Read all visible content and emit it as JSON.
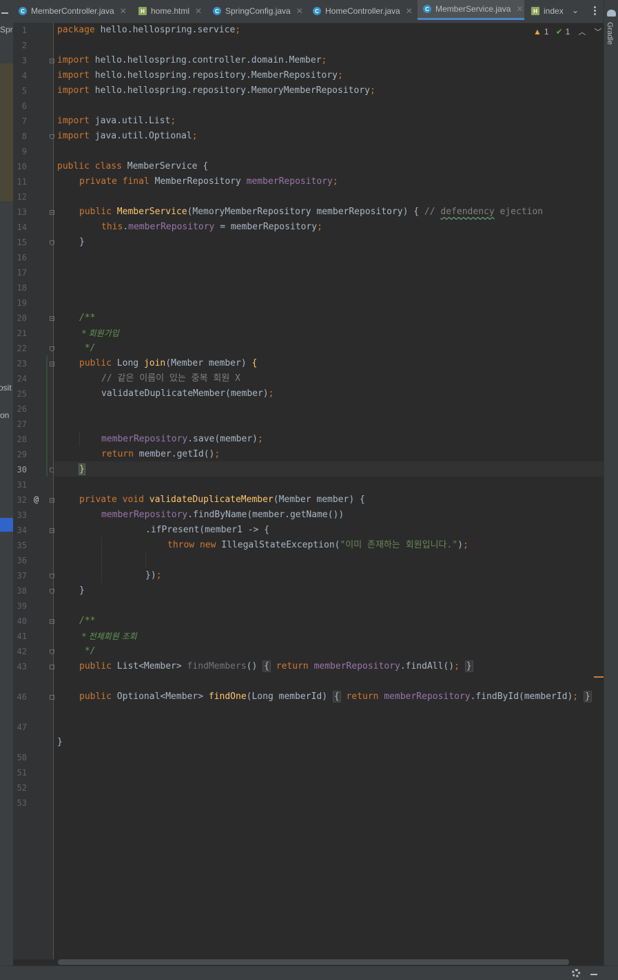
{
  "tabs": [
    {
      "label": "MemberController.java",
      "icon": "java-class-icon",
      "active": false
    },
    {
      "label": "home.html",
      "icon": "html-file-icon",
      "active": false
    },
    {
      "label": "SpringConfig.java",
      "icon": "java-class-icon",
      "active": false
    },
    {
      "label": "HomeController.java",
      "icon": "java-class-icon",
      "active": false
    },
    {
      "label": "MemberService.java",
      "icon": "java-class-icon",
      "active": true
    },
    {
      "label": "index",
      "icon": "html-file-icon",
      "active": false
    }
  ],
  "left_pane_fragments": {
    "top": "Spr",
    "mid1": "osit",
    "mid2": "on"
  },
  "right_tool_window": {
    "label": "Gradle"
  },
  "inspection": {
    "warnings": "1",
    "ok": "1"
  },
  "editor": {
    "current_line": "30",
    "line_numbers": [
      "1",
      "2",
      "3",
      "4",
      "5",
      "6",
      "7",
      "8",
      "9",
      "10",
      "11",
      "12",
      "13",
      "14",
      "15",
      "16",
      "17",
      "18",
      "19",
      "20",
      "21",
      "22",
      "23",
      "24",
      "25",
      "26",
      "27",
      "28",
      "29",
      "30",
      "31",
      "32",
      "33",
      "34",
      "35",
      "36",
      "37",
      "38",
      "39",
      "40",
      "41",
      "42",
      "43",
      "46",
      "47",
      "50",
      "51",
      "52",
      "53"
    ],
    "code": {
      "l1_kw": "package",
      "l1_rest": " hello.hellospring.service",
      "l3_kw": "import",
      "l3_rest": " hello.hellospring.controller.domain.Member",
      "l4_kw": "import",
      "l4_rest": " hello.hellospring.repository.MemberRepository",
      "l5_kw": "import",
      "l5_rest": " hello.hellospring.repository.MemoryMemberRepository",
      "l7_kw": "import",
      "l7_rest": " java.util.List",
      "l8_kw": "import",
      "l8_rest": " java.util.Optional",
      "l10_kw": "public class",
      "l10_rest": " MemberService {",
      "l11_kw": "private final",
      "l11_type": " MemberRepository ",
      "l11_field": "memberRepository",
      "l13_kw": "public",
      "l13_fn": "MemberService",
      "l13_params": "(MemoryMemberRepository memberRepository) { ",
      "l13_cm1": "// ",
      "l13_typo": "defendency",
      "l13_cm2": " ejection",
      "l14_this": "this",
      "l14_dot": ".",
      "l14_field": "memberRepository",
      "l14_rest": " = memberRepository",
      "l15": "}",
      "l20": "/**",
      "l21": " * 회원가입",
      "l22": " */",
      "l23_kw": "public",
      "l23_type": " Long ",
      "l23_fn": "join",
      "l23_params": "(Member member) ",
      "l23_brace": "{",
      "l24": "// 같은 이름이 있는 중복 회원 X",
      "l25": "validateDuplicateMember(member)",
      "l28_field": "memberRepository",
      "l28_rest": ".save(member)",
      "l29_kw": "return",
      "l29_rest": " member.getId()",
      "l30_brace": "}",
      "l32_kw": "private void",
      "l32_fn": "validateDuplicateMember",
      "l32_params": "(Member member) {",
      "l33_field": "memberRepository",
      "l33_rest": ".findByName(member.getName())",
      "l34": ".ifPresent(member1 -> {",
      "l35_kw": "throw new",
      "l35_type": " IllegalStateException(",
      "l35_str": "\"이미 존재하는 회원입니다.\"",
      "l35_end": ")",
      "l37": "})",
      "l38": "}",
      "l40": "/**",
      "l41": " * 전체회원 조회",
      "l42": " */",
      "l43_kw": "public",
      "l43_type": " List<Member> ",
      "l43_fn": "findMembers",
      "l43_params": "() ",
      "l43_open": "{",
      "l43_kw2": "return",
      "l43_field": "memberRepository",
      "l43_rest": ".findAll()",
      "l43_close": "}",
      "l47_kw": "public",
      "l47_type": " Optional<Member> ",
      "l47_fn": "findOne",
      "l47_params": "(Long memberId) ",
      "l47_open": "{",
      "l47_kw2": "return",
      "l47_field": "memberRepository",
      "l47_rest": ".findById(memberId)",
      "l47_close": "}",
      "l52": "}",
      "semicolon": ";",
      "at_marker": "@"
    }
  }
}
